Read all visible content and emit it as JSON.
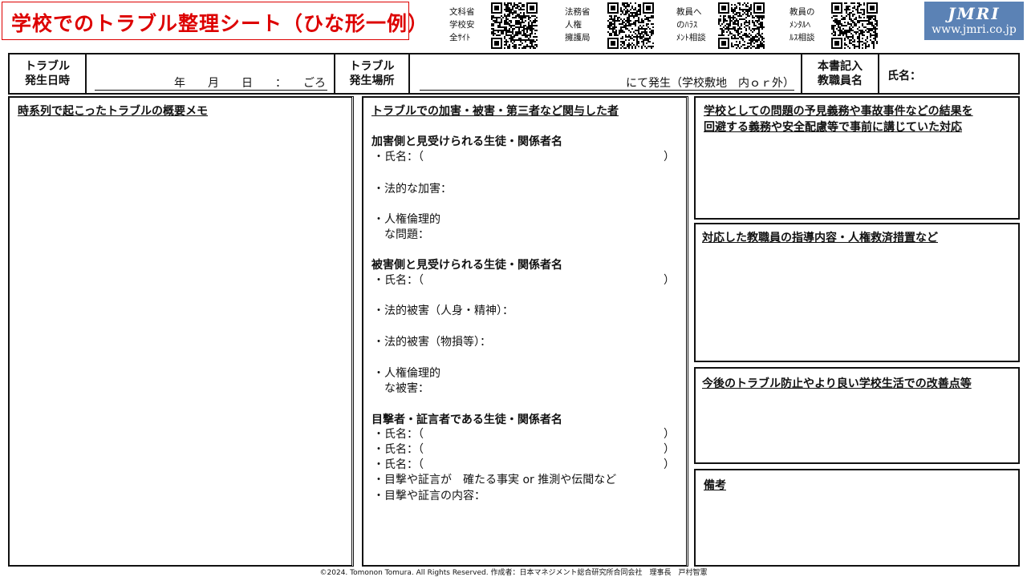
{
  "title": "学校でのトラブル整理シート（ひな形一例）",
  "qr_links": [
    {
      "label_lines": [
        "文科省",
        "学校安",
        "全ｻｲﾄ"
      ]
    },
    {
      "label_lines": [
        "法務省",
        "人権",
        "擁護局"
      ]
    },
    {
      "label_lines": [
        "教員へ",
        "のﾊﾗｽ",
        "ﾒﾝﾄ相談"
      ]
    },
    {
      "label_lines": [
        "教員の",
        "ﾒﾝﾀﾙﾍ",
        "ﾙｽ相談"
      ]
    }
  ],
  "brand": {
    "name": "JMRI",
    "url": "www.jmri.co.jp"
  },
  "header": {
    "date_label": "トラブル\n発生日時",
    "date_template": "年　　月　　日　　：　　ごろ",
    "place_label": "トラブル\n発生場所",
    "place_template": "にて発生（学校敷地　内ｏｒ外）",
    "staff_label": "本書記入\n教職員名",
    "name_label": "氏名："
  },
  "panels": {
    "memo_title": "時系列で起こったトラブルの概要メモ",
    "involved": {
      "title": "トラブルでの加害・被害・第三者など関与した者",
      "perp_heading": "加害側と見受けられる生徒・関係者名",
      "perp_name": "・氏名：（",
      "perp_name_close": "）",
      "perp_legal": "・法的な加害：",
      "perp_ethic_1": "・人権倫理的",
      "perp_ethic_2": "な問題：",
      "victim_heading": "被害側と見受けられる生徒・関係者名",
      "victim_name": "・氏名：（",
      "victim_name_close": "）",
      "victim_damage_body": "・法的被害（人身・精神）：",
      "victim_damage_property": "・法的被害（物損等）：",
      "victim_ethic_1": "・人権倫理的",
      "victim_ethic_2": "な被害：",
      "witness_heading": "目撃者・証言者である生徒・関係者名",
      "witness_names": [
        "・氏名：（",
        "・氏名：（",
        "・氏名：（"
      ],
      "witness_close": "）",
      "witness_fact": "・目撃や証言が　確たる事実 or 推測や伝聞など",
      "witness_content": "・目撃や証言の内容："
    },
    "school_title_1": "学校としての問題の予見義務や事故事件などの結果を",
    "school_title_2": "回避する義務や安全配慮等で事前に講じていた対応",
    "response_title": "対応した教職員の指導内容・人権救済措置など",
    "improve_title": "今後のトラブル防止やより良い学校生活での改善点等",
    "notes_title": "備考"
  },
  "footer": "©2024. Tomonon Tomura. All Rights Reserved.  作成者：日本マネジメント総合研究所合同会社　理事長　戸村智憲"
}
